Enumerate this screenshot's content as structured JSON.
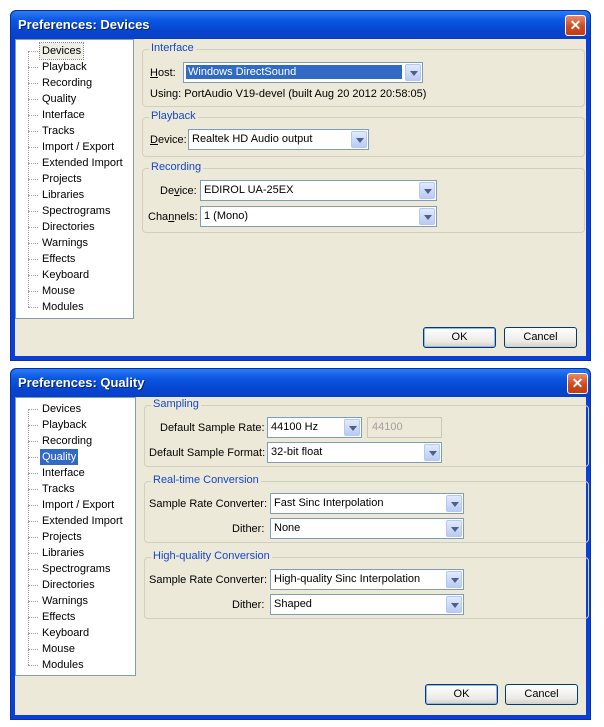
{
  "devices": {
    "title": "Preferences: Devices",
    "tree": [
      "Devices",
      "Playback",
      "Recording",
      "Quality",
      "Interface",
      "Tracks",
      "Import / Export",
      "Extended Import",
      "Projects",
      "Libraries",
      "Spectrograms",
      "Directories",
      "Warnings",
      "Effects",
      "Keyboard",
      "Mouse",
      "Modules"
    ],
    "tree_focused": "Devices",
    "interface": {
      "group_title": "Interface",
      "host_label_u": "H",
      "host_label_rest": "ost:",
      "host_value": "Windows DirectSound",
      "using_text": "Using: PortAudio V19-devel (built Aug 20 2012 20:58:05)"
    },
    "playback": {
      "group_title": "Playback",
      "device_label_u": "D",
      "device_label_rest": "evice:",
      "device_value": "Realtek HD Audio output"
    },
    "recording": {
      "group_title": "Recording",
      "device_label_pre": "De",
      "device_label_u": "v",
      "device_label_rest": "ice:",
      "device_value": "EDIROL UA-25EX",
      "channels_label_pre": "Cha",
      "channels_label_u": "n",
      "channels_label_rest": "nels:",
      "channels_value": "1 (Mono)"
    },
    "ok_label": "OK",
    "cancel_label": "Cancel"
  },
  "quality": {
    "title": "Preferences: Quality",
    "tree": [
      "Devices",
      "Playback",
      "Recording",
      "Quality",
      "Interface",
      "Tracks",
      "Import / Export",
      "Extended Import",
      "Projects",
      "Libraries",
      "Spectrograms",
      "Directories",
      "Warnings",
      "Effects",
      "Keyboard",
      "Mouse",
      "Modules"
    ],
    "tree_selected": "Quality",
    "sampling": {
      "group_title": "Sampling",
      "rate_label": "Default Sample Rate:",
      "rate_value": "44100 Hz",
      "rate_custom": "44100",
      "format_label": "Default Sample Format:",
      "format_value": "32-bit float"
    },
    "realtime": {
      "group_title": "Real-time Conversion",
      "converter_label": "Sample Rate Converter:",
      "converter_value": "Fast Sinc Interpolation",
      "dither_label": "Dither:",
      "dither_value": "None"
    },
    "highquality": {
      "group_title": "High-quality Conversion",
      "converter_label": "Sample Rate Converter:",
      "converter_value": "High-quality Sinc Interpolation",
      "dither_label": "Dither:",
      "dither_value": "Shaped"
    },
    "ok_label": "OK",
    "cancel_label": "Cancel"
  },
  "icons": {
    "close": "close-icon",
    "dropdown": "chevron-down-icon"
  }
}
